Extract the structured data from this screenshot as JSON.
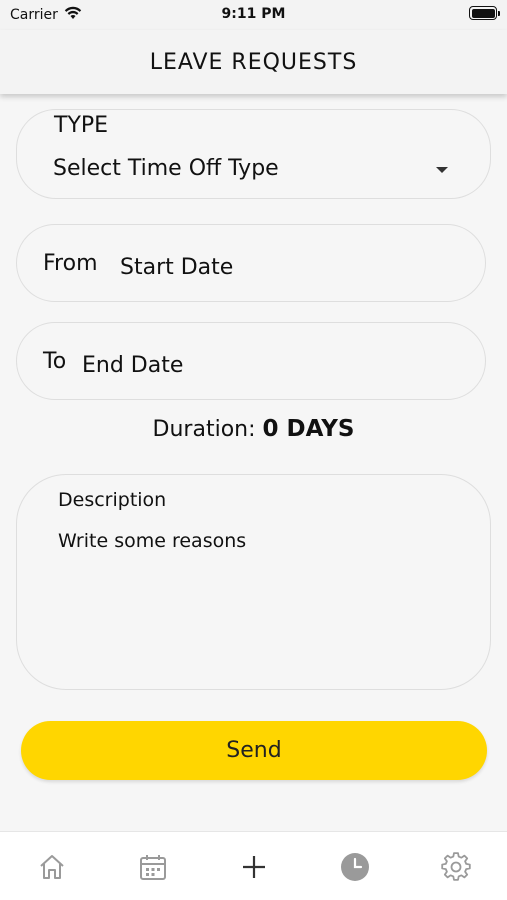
{
  "status_bar": {
    "carrier": "Carrier",
    "time": "9:11 PM"
  },
  "header": {
    "title": "LEAVE REQUESTS"
  },
  "form": {
    "type_label": "TYPE",
    "type_value": "Select Time Off Type",
    "from_label": "From",
    "from_value": "Start Date",
    "to_label": "To",
    "to_value": "End Date",
    "duration_label": "Duration:",
    "duration_value": "0 DAYS",
    "description_label": "Description",
    "description_placeholder": "Write some reasons",
    "send_label": "Send"
  },
  "tabbar": {
    "items": [
      {
        "icon": "home-icon"
      },
      {
        "icon": "calendar-icon"
      },
      {
        "icon": "plus-icon"
      },
      {
        "icon": "clock-icon",
        "active": true
      },
      {
        "icon": "gear-icon"
      }
    ]
  },
  "colors": {
    "accent": "#ffd600",
    "background": "#f6f6f6",
    "icon": "#9a9a9a"
  }
}
